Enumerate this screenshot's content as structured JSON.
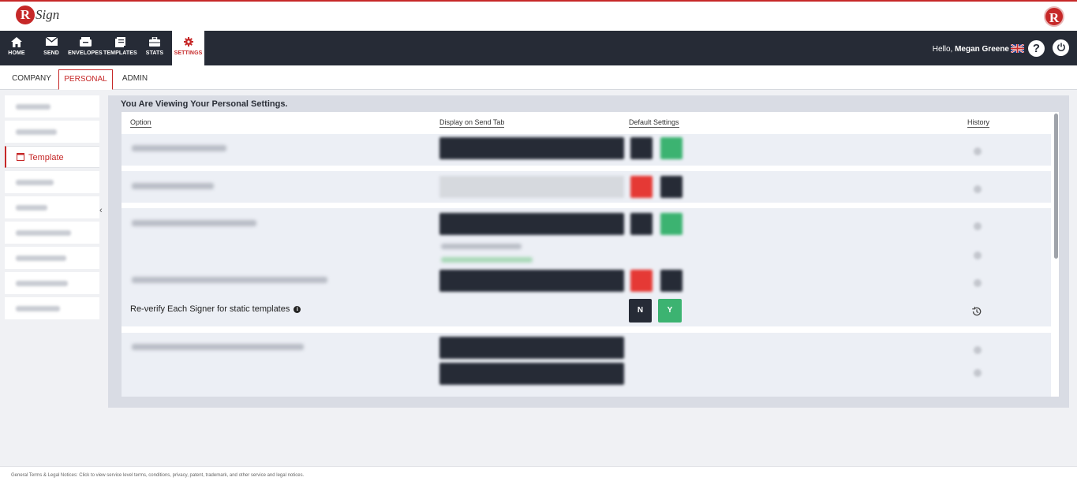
{
  "brand": {
    "logo_letter": "R",
    "logo_word": "Sign",
    "right_logo_letter": "R"
  },
  "nav": {
    "items": [
      {
        "label": "HOME",
        "icon": "home-icon"
      },
      {
        "label": "SEND",
        "icon": "envelope-icon"
      },
      {
        "label": "ENVELOPES",
        "icon": "inbox-icon"
      },
      {
        "label": "TEMPLATES",
        "icon": "template-icon"
      },
      {
        "label": "STATS",
        "icon": "briefcase-icon"
      },
      {
        "label": "SETTINGS",
        "icon": "gear-icon"
      }
    ],
    "active": "SETTINGS",
    "greeting": "Hello,",
    "user_name": "Megan Greene",
    "help_label": "?"
  },
  "tabs": {
    "items": [
      "COMPANY",
      "PERSONAL",
      "ADMIN"
    ],
    "active": "PERSONAL"
  },
  "sidebar": {
    "active_label": "Template",
    "collapse_glyph": "‹"
  },
  "panel": {
    "title": "You Are Viewing Your Personal Settings.",
    "columns": {
      "option": "Option",
      "display": "Display on Send Tab",
      "default": "Default Settings",
      "history": "History"
    },
    "visible_row": {
      "label": "Re-verify Each Signer for static templates",
      "info_glyph": "i",
      "no_label": "N",
      "yes_label": "Y"
    }
  },
  "footer": {
    "text": "General Terms & Legal Notices: Click to view service level terms, conditions, privacy, patent, trademark, and other service and legal notices."
  },
  "colors": {
    "accent": "#c62828",
    "nav_bg": "#262b36",
    "yes_green": "#3cb371",
    "no_dark": "#262b36"
  }
}
